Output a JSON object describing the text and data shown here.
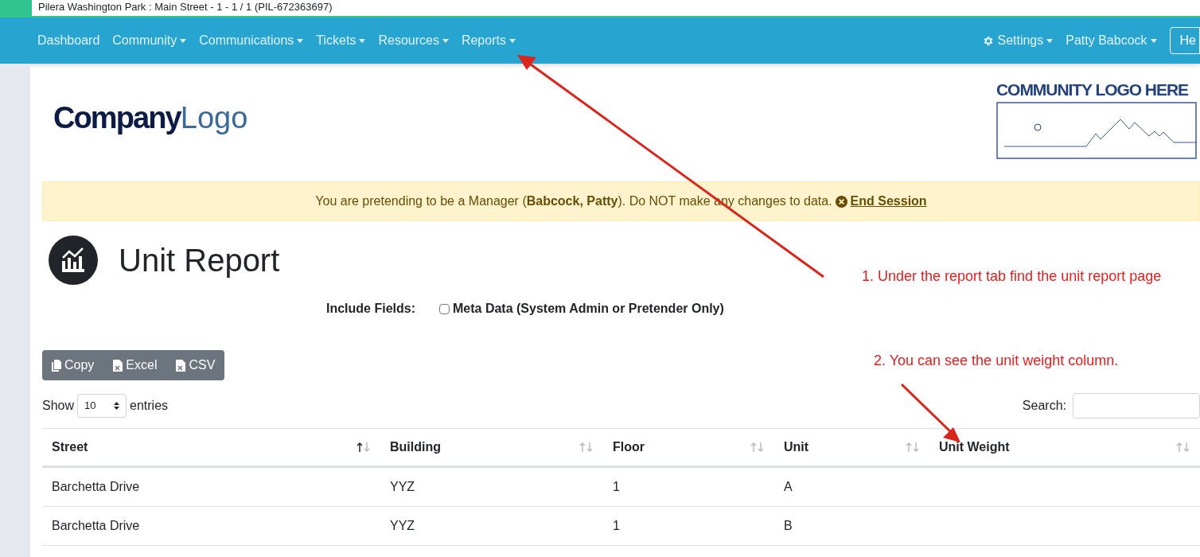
{
  "browser_tab": {
    "title": "Pilera Washington Park : Main Street - 1 - 1 / 1 (PIL-672363697)"
  },
  "navbar": {
    "items": [
      {
        "label": "Dashboard",
        "dropdown": false
      },
      {
        "label": "Community",
        "dropdown": true
      },
      {
        "label": "Communications",
        "dropdown": true
      },
      {
        "label": "Tickets",
        "dropdown": true
      },
      {
        "label": "Resources",
        "dropdown": true
      },
      {
        "label": "Reports",
        "dropdown": true
      }
    ],
    "right_items": [
      {
        "label": "Settings",
        "dropdown": true,
        "kind": "gear"
      },
      {
        "label": "Patty Babcock",
        "dropdown": true,
        "kind": "plain"
      }
    ],
    "button": "He"
  },
  "company_logo": {
    "bold": "Company",
    "light": "Logo"
  },
  "community_logo": {
    "title": "COMMUNITY LOGO HERE"
  },
  "alert": {
    "text": "You are pretending to be a Manager (**Babcock, Patty**). Do NOT make any changes to data.",
    "link": "End Session"
  },
  "page_title": "Unit Report",
  "include_fields": {
    "label": "Include Fields:",
    "options": [
      {
        "label": "Meta Data (System Admin or Pretender Only)",
        "checked": false
      }
    ]
  },
  "export_buttons": [
    "Copy",
    "Excel",
    "CSV"
  ],
  "length": {
    "before": "Show",
    "value": "10",
    "after": "entries"
  },
  "search": {
    "label": "Search:"
  },
  "table": {
    "columns": [
      {
        "label": "Street",
        "sorted": true
      },
      {
        "label": "Building",
        "sorted": false
      },
      {
        "label": "Floor",
        "sorted": false
      },
      {
        "label": "Unit",
        "sorted": false
      },
      {
        "label": "Unit Weight",
        "sorted": false
      }
    ],
    "rows": [
      [
        "Barchetta Drive",
        "YYZ",
        "1",
        "A",
        ""
      ],
      [
        "Barchetta Drive",
        "YYZ",
        "1",
        "B",
        ""
      ]
    ]
  },
  "annotations": [
    "1. Under the report tab find the unit report page",
    "2. You can see the unit weight column."
  ]
}
